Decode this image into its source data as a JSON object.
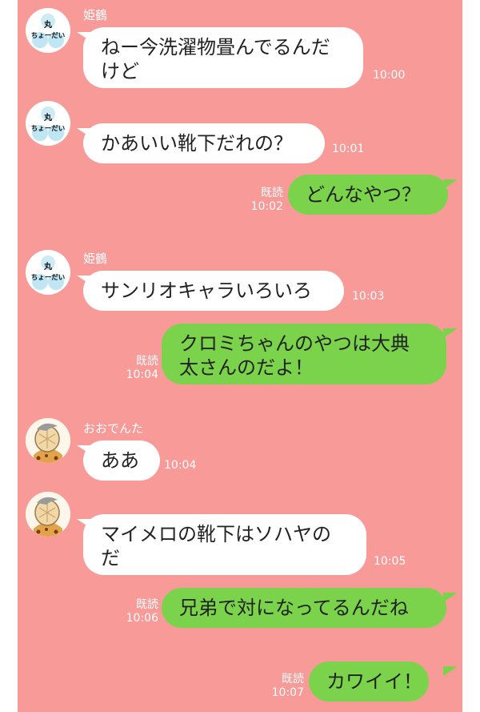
{
  "messages": [
    {
      "sender": "姫鶴",
      "lines": [
        "ねー今洗濯物畳んでるんだ",
        "けど"
      ],
      "time": "10:00"
    },
    {
      "lines": [
        "かあいい靴下だれの？"
      ],
      "time": "10:01"
    },
    {
      "lines": [
        "どんなやつ？"
      ],
      "read": "既読",
      "time": "10:02"
    },
    {
      "sender": "姫鶴",
      "lines": [
        "サンリオキャラいろいろ"
      ],
      "time": "10:03"
    },
    {
      "lines": [
        "クロミちゃんのやつは大典",
        "太さんのだよ！"
      ],
      "read": "既読",
      "time": "10:04"
    },
    {
      "sender": "おおでんた",
      "lines": [
        "ああ"
      ],
      "time": "10:04"
    },
    {
      "lines": [
        "マイメロの靴下はソハヤの",
        "だ"
      ],
      "time": "10:05"
    },
    {
      "lines": [
        "兄弟で対になってるんだね"
      ],
      "read": "既読",
      "time": "10:06"
    },
    {
      "lines": [
        "カワイイ！"
      ],
      "read": "既読",
      "time": "10:07"
    }
  ],
  "avatars": {
    "himetsuru": {
      "icon": "maru-choudai-sticker-icon",
      "text_top": "丸",
      "text_bottom": "ちょーだい"
    },
    "oodenta": {
      "icon": "character-avatar-icon"
    }
  },
  "colors": {
    "background": "#f79a98",
    "incoming": "#ffffff",
    "outgoing": "#7bd34c",
    "meta_text": "#ffffff"
  }
}
